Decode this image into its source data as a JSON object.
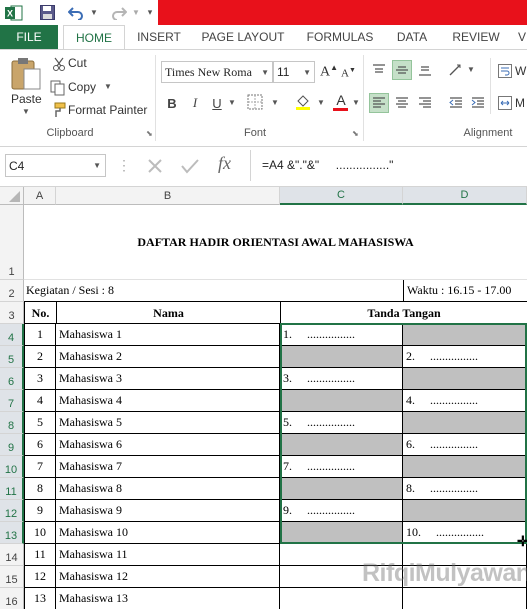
{
  "qat": {
    "icons": [
      "excel-logo-icon",
      "save-icon",
      "undo-icon",
      "redo-icon",
      "customize-icon"
    ]
  },
  "tabs": [
    "FILE",
    "HOME",
    "INSERT",
    "PAGE LAYOUT",
    "FORMULAS",
    "DATA",
    "REVIEW",
    "V"
  ],
  "ribbon": {
    "clipboard": {
      "paste": "Paste",
      "cut": "Cut",
      "copy": "Copy",
      "format_painter": "Format Painter",
      "label": "Clipboard"
    },
    "font": {
      "family": "Times New Roma",
      "size": "11",
      "bold": "B",
      "italic": "I",
      "underline": "U",
      "font_color_letter": "A",
      "grow": "A",
      "shrink": "A",
      "label": "Font"
    },
    "alignment": {
      "label": "Alignment",
      "wrap": "W",
      "merge": "M"
    }
  },
  "formula_bar": {
    "name_box": "C4",
    "fx": "fx",
    "formula": "=A4 &\".\"&\"     ................\""
  },
  "sheet": {
    "columns": [
      "A",
      "B",
      "C",
      "D"
    ],
    "title": "DAFTAR HADIR ORIENTASI AWAL MAHASISWA",
    "kegiatan": "Kegiatan / Sesi : 8",
    "waktu": "Waktu : 16.15 - 17.00",
    "headers": {
      "no": "No.",
      "nama": "Nama",
      "tanda": "Tanda Tangan"
    },
    "rows": [
      {
        "row": "4",
        "no": "1",
        "nama": "Mahasiswa 1",
        "c": "1.     ................",
        "d": ""
      },
      {
        "row": "5",
        "no": "2",
        "nama": "Mahasiswa 2",
        "c": "",
        "d": "2.     ................"
      },
      {
        "row": "6",
        "no": "3",
        "nama": "Mahasiswa 3",
        "c": "3.     ................",
        "d": ""
      },
      {
        "row": "7",
        "no": "4",
        "nama": "Mahasiswa 4",
        "c": "",
        "d": "4.     ................"
      },
      {
        "row": "8",
        "no": "5",
        "nama": "Mahasiswa 5",
        "c": "5.     ................",
        "d": ""
      },
      {
        "row": "9",
        "no": "6",
        "nama": "Mahasiswa 6",
        "c": "",
        "d": "6.     ................"
      },
      {
        "row": "10",
        "no": "7",
        "nama": "Mahasiswa 7",
        "c": "7.     ................",
        "d": ""
      },
      {
        "row": "11",
        "no": "8",
        "nama": "Mahasiswa 8",
        "c": "",
        "d": "8.     ................"
      },
      {
        "row": "12",
        "no": "9",
        "nama": "Mahasiswa 9",
        "c": "9.     ................",
        "d": ""
      },
      {
        "row": "13",
        "no": "10",
        "nama": "Mahasiswa 10",
        "c": "",
        "d": "10.     ................"
      },
      {
        "row": "14",
        "no": "11",
        "nama": "Mahasiswa 11",
        "c": "",
        "d": ""
      },
      {
        "row": "15",
        "no": "12",
        "nama": "Mahasiswa 12",
        "c": "",
        "d": ""
      },
      {
        "row": "16",
        "no": "13",
        "nama": "Mahasiswa 13",
        "c": "",
        "d": ""
      }
    ],
    "row_labels": {
      "r1": "1",
      "r2": "2",
      "r3": "3"
    }
  },
  "watermark": "RifqiMulyawan",
  "colors": {
    "excel_green": "#217346",
    "title_red": "#e8111b",
    "signature_gray": "#c0c0c0"
  }
}
